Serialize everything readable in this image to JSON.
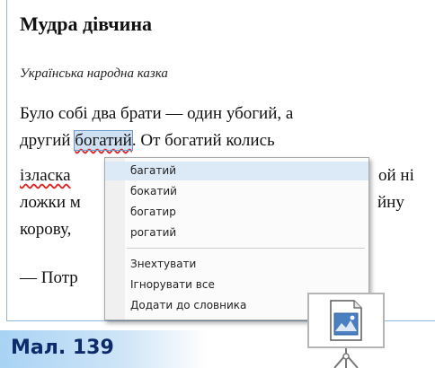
{
  "document": {
    "title": "Мудра дівчина",
    "subtitle": "Українська народна казка",
    "lines": [
      {
        "before": "Було собі два брати — один убогий, а"
      },
      {
        "before": "другий ",
        "word": "богатий",
        "after": ". От богатий колись"
      },
      {
        "word": "ізласка"
      },
      {
        "before": "ложки м"
      },
      {
        "before": "корову,"
      },
      {
        "before": "— Потр"
      }
    ],
    "right_fragments": [
      "ой ні",
      "йну"
    ]
  },
  "context_menu": {
    "suggestions": [
      "багатий",
      "бокатий",
      "богатир",
      "рогатий"
    ],
    "actions": [
      "Знехтувати",
      "Ігнорувати все",
      "Додати до словника"
    ]
  },
  "caption": "Мал. 139",
  "colors": {
    "highlight": "#cfe0f3",
    "misspell": "#dd2222",
    "caption": "#0d2a6a",
    "band": "#a9d3f4"
  },
  "icons": [
    "image-file-icon",
    "presentation-board-icon"
  ]
}
